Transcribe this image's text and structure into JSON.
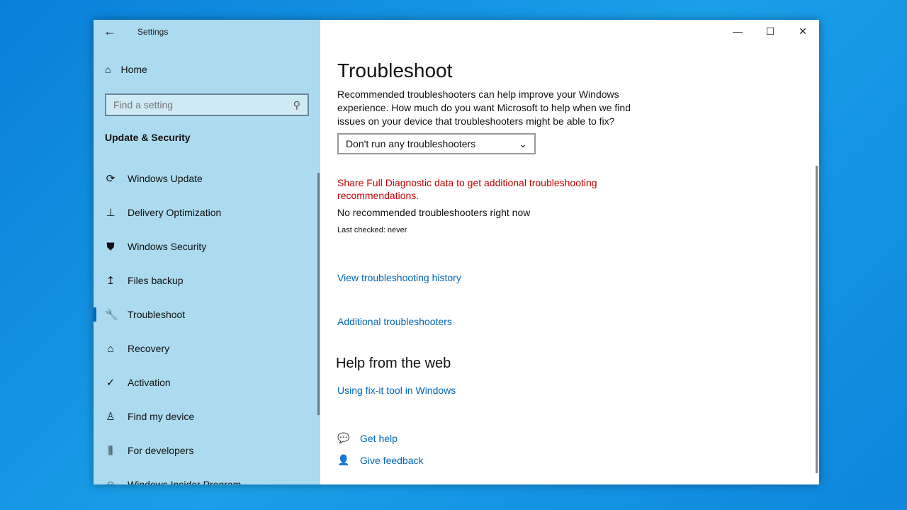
{
  "window": {
    "title": "Settings",
    "controls": {
      "minimize": "—",
      "maximize": "☐",
      "close": "✕"
    }
  },
  "sidebar": {
    "home": "Home",
    "search_placeholder": "Find a setting",
    "section": "Update & Security",
    "items": [
      {
        "label": "Windows Update",
        "icon": "⟳"
      },
      {
        "label": "Delivery Optimization",
        "icon": "⊥"
      },
      {
        "label": "Windows Security",
        "icon": "⛊"
      },
      {
        "label": "Files backup",
        "icon": "↥"
      },
      {
        "label": "Troubleshoot",
        "icon": "🔧"
      },
      {
        "label": "Recovery",
        "icon": "⌂"
      },
      {
        "label": "Activation",
        "icon": "✓"
      },
      {
        "label": "Find my device",
        "icon": "♙"
      },
      {
        "label": "For developers",
        "icon": "⫼"
      },
      {
        "label": "Windows Insider Program",
        "icon": "☺"
      }
    ],
    "selected": "Troubleshoot"
  },
  "main": {
    "title": "Troubleshoot",
    "description": "Recommended troubleshooters can help improve your Windows experience. How much do you want Microsoft to help when we find issues on your device that troubleshooters might be able to fix?",
    "dropdown_value": "Don't run any troubleshooters",
    "warning": "Share Full Diagnostic data to get additional troubleshooting recommendations.",
    "no_recommended": "No recommended troubleshooters right now",
    "last_checked": "Last checked: never",
    "history_link": "View troubleshooting history",
    "additional_link": "Additional troubleshooters",
    "help_heading": "Help from the web",
    "fixit_link": "Using fix-it tool in Windows",
    "get_help": "Get help",
    "give_feedback": "Give feedback"
  }
}
